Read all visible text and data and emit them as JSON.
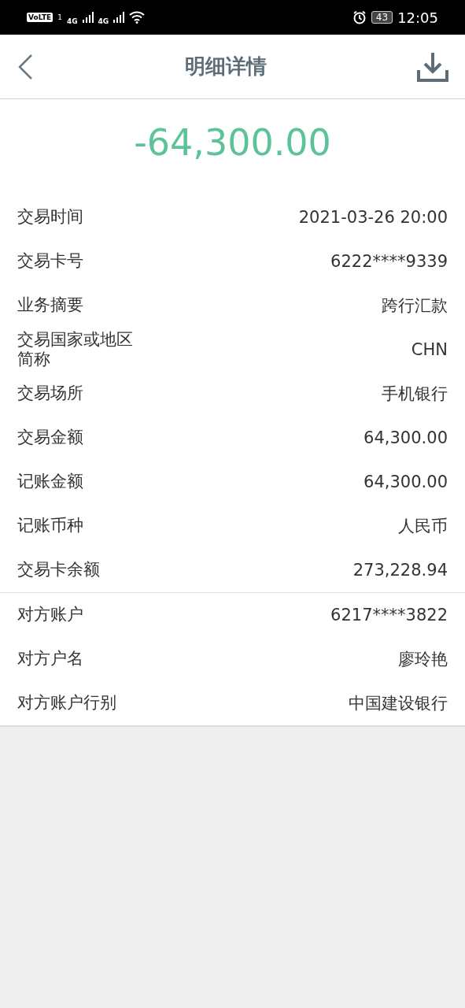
{
  "status_bar": {
    "volte": "VoLTE",
    "sim": "1",
    "network_1": "4G",
    "network_2": "4G",
    "battery": "43",
    "time": "12:05"
  },
  "header": {
    "title": "明细详情"
  },
  "amount": "-64,300.00",
  "sections": [
    {
      "rows": [
        {
          "label": "交易时间",
          "value": "2021-03-26 20:00"
        },
        {
          "label": "交易卡号",
          "value": "6222****9339"
        },
        {
          "label": "业务摘要",
          "value": "跨行汇款"
        },
        {
          "label": "交易国家或地区简称",
          "value": "CHN"
        },
        {
          "label": "交易场所",
          "value": "手机银行"
        },
        {
          "label": "交易金额",
          "value": "64,300.00"
        },
        {
          "label": "记账金额",
          "value": "64,300.00"
        },
        {
          "label": "记账币种",
          "value": "人民币"
        },
        {
          "label": "交易卡余额",
          "value": "273,228.94"
        }
      ]
    },
    {
      "rows": [
        {
          "label": "对方账户",
          "value": "6217****3822"
        },
        {
          "label": "对方户名",
          "value": "廖玲艳"
        },
        {
          "label": "对方账户行别",
          "value": "中国建设银行"
        }
      ]
    }
  ]
}
